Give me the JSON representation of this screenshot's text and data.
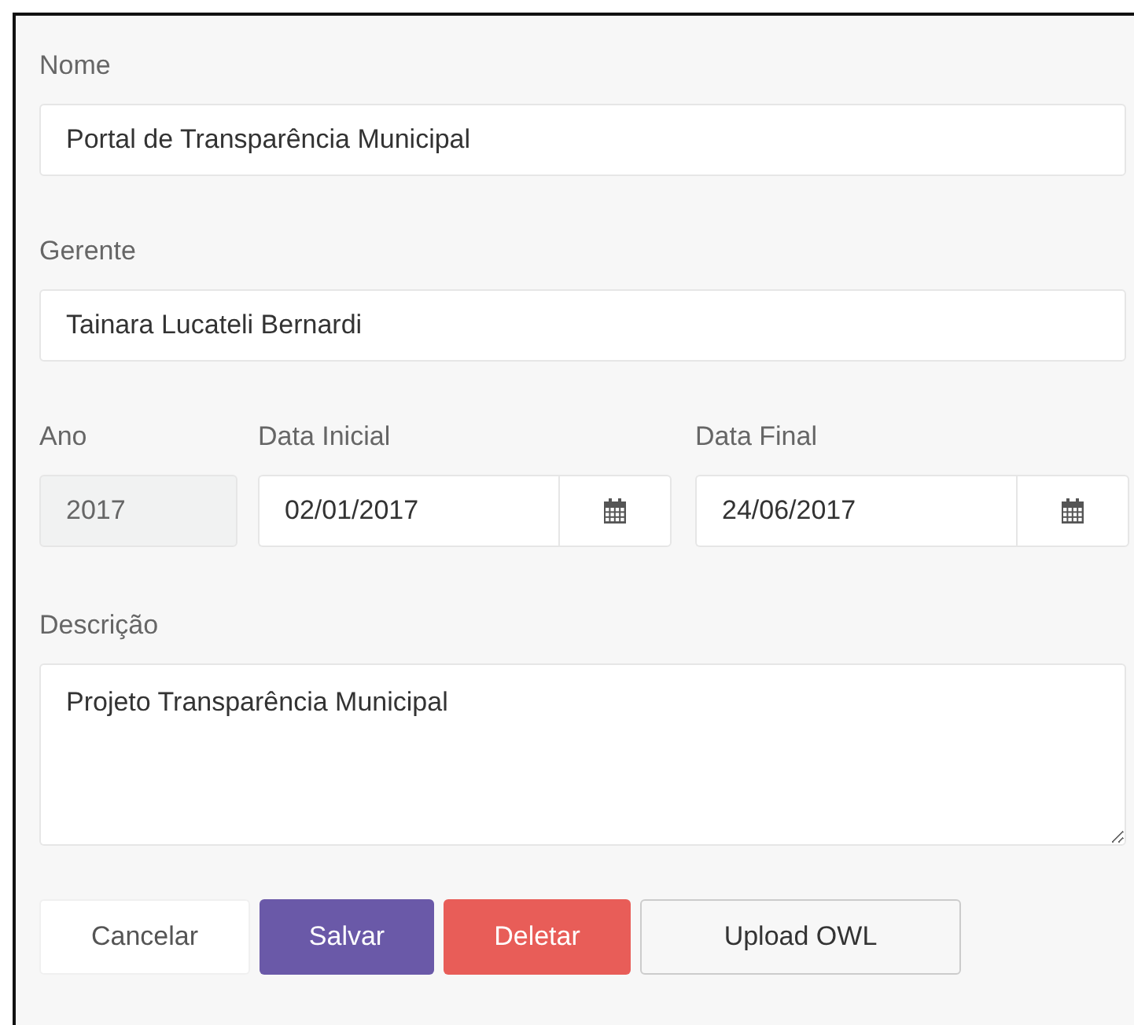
{
  "fields": [
    {
      "label": "Nome",
      "value": "Portal de Transparência Municipal"
    },
    {
      "label": "Gerente",
      "value": "Tainara Lucateli Bernardi"
    }
  ],
  "date_row": {
    "year": {
      "label": "Ano",
      "value": "2017",
      "disabled": true
    },
    "dates": [
      {
        "label": "Data Inicial",
        "value": "02/01/2017"
      },
      {
        "label": "Data Final",
        "value": "24/06/2017"
      }
    ]
  },
  "description": {
    "label": "Descrição",
    "value": "Projeto Transparência Municipal"
  },
  "buttons": [
    {
      "label": "Cancelar",
      "kind": "default"
    },
    {
      "label": "Salvar",
      "kind": "primary"
    },
    {
      "label": "Deletar",
      "kind": "danger"
    },
    {
      "label": "Upload OWL",
      "kind": "outline"
    }
  ]
}
